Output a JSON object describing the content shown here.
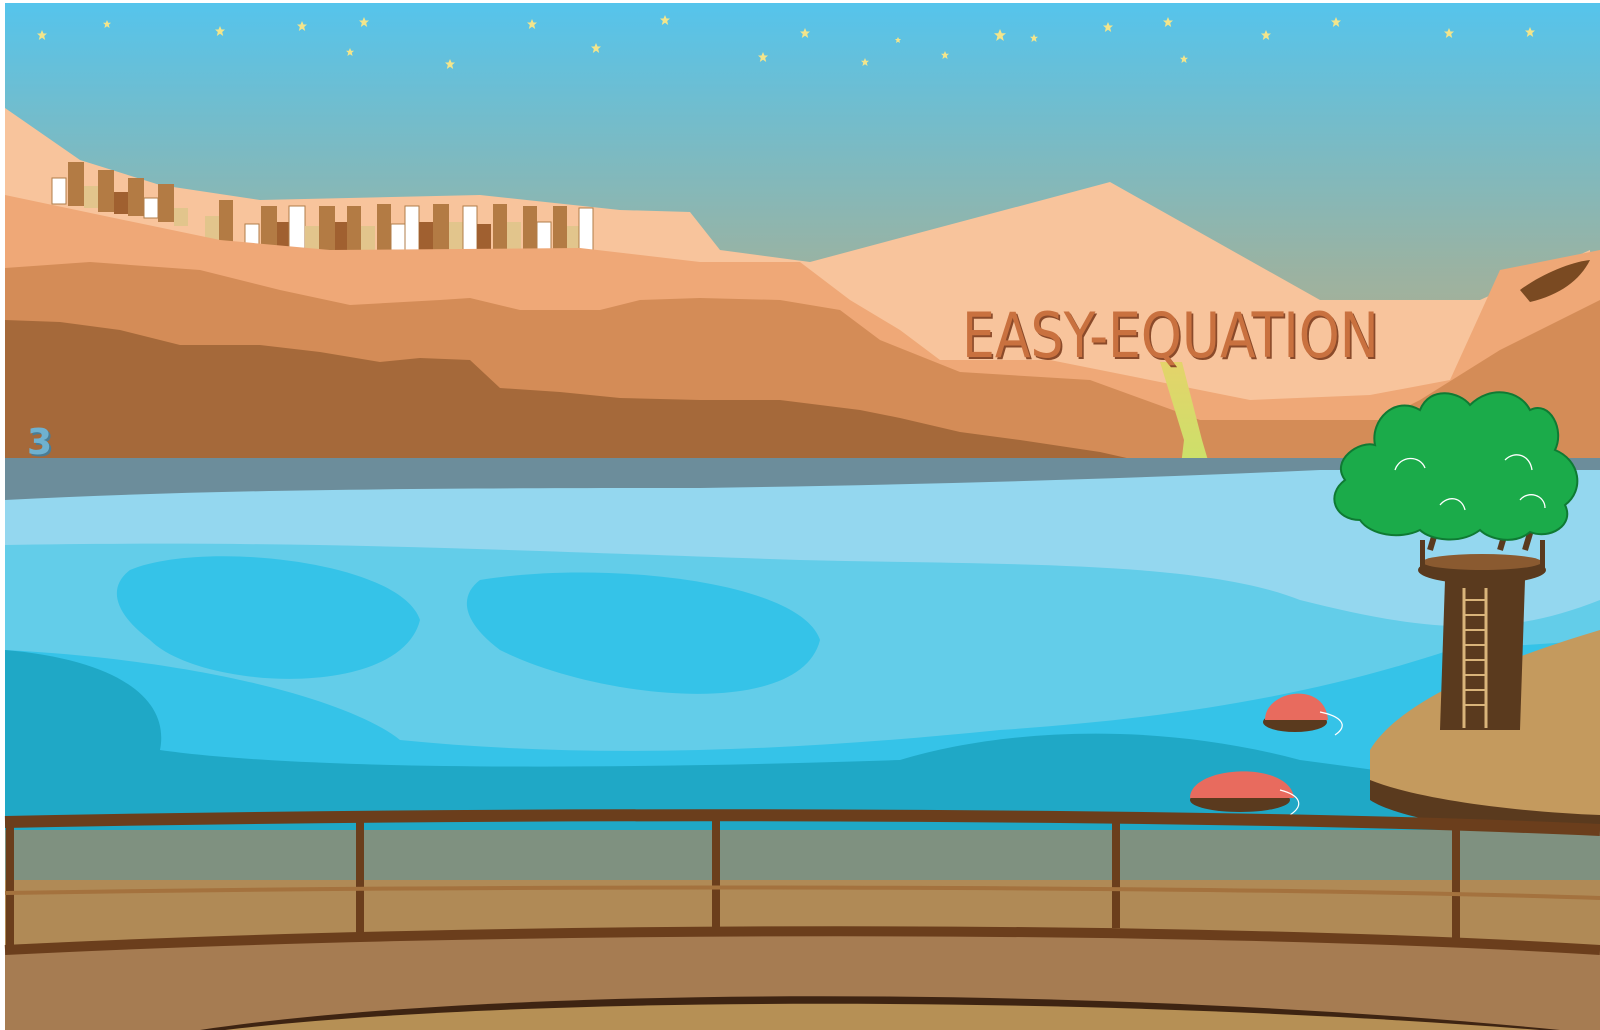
{
  "game": {
    "title": "EASY-EQUATION",
    "level_number": "3"
  },
  "colors": {
    "sky_top": "#55c4ec",
    "sky_bottom": "#c6a77a",
    "title_text": "#c9713f",
    "water": "#35c3e8",
    "tree_green": "#1bab4a",
    "buoy": "#e86b5e",
    "railing": "#6b3e1c"
  },
  "icons": [
    "star-icon",
    "buoy-icon",
    "treehouse-icon",
    "railing-icon",
    "waterfall-icon"
  ]
}
